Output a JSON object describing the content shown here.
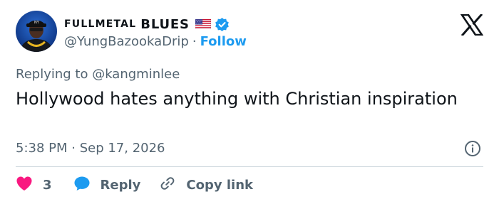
{
  "author": {
    "display_name_small": "FULLMETAL",
    "display_name_big": "BLUES",
    "handle": "@YungBazookaDrip",
    "separator": "·",
    "follow_label": "Follow",
    "flag": "us-flag-icon",
    "verified": "verified-badge-icon"
  },
  "reply_context": {
    "prefix": "Replying to ",
    "mention": "@kangminlee"
  },
  "tweet": {
    "text": "Hollywood hates anything with Christian inspiration",
    "timestamp": "5:38 PM · Sep 17, 2026"
  },
  "actions": {
    "like_count": "3",
    "reply_label": "Reply",
    "copy_label": "Copy link"
  },
  "colors": {
    "accent": "#1d9bf0",
    "like": "#f91880",
    "muted": "#536471",
    "text": "#0f1419",
    "divider": "#cfd9de"
  },
  "icons": [
    "avatar",
    "us-flag-icon",
    "verified-badge-icon",
    "x-logo-icon",
    "info-icon",
    "heart-icon",
    "reply-bubble-icon",
    "link-icon"
  ]
}
